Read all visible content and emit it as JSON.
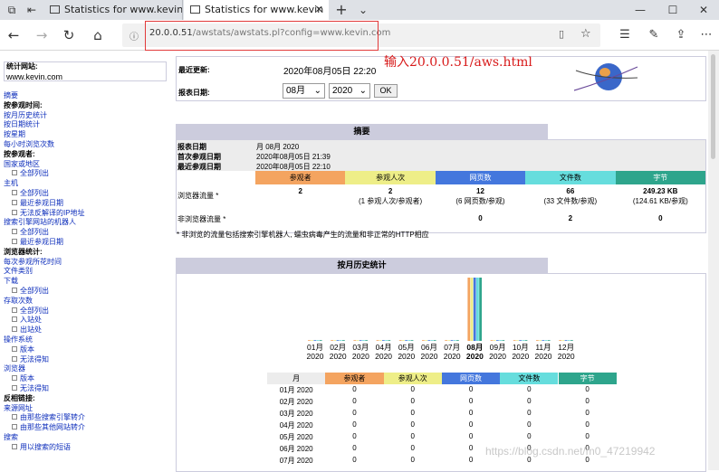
{
  "browser": {
    "tab1_title": "Statistics for www.kevin.com",
    "tab2_title": "Statistics for www.kevin",
    "url_host": "20.0.0.51",
    "url_path": "/awstats/awstats.pl?config=www.kevin.com",
    "annotation": "输入20.0.0.51/aws.html"
  },
  "sidebar": {
    "site_label": "统计网站:",
    "site_value": "www.kevin.com",
    "items": [
      {
        "t": "摘要",
        "s": "link",
        "l": 0
      },
      {
        "t": "按参观时间:",
        "s": "bold",
        "l": 0
      },
      {
        "t": "按月历史统计",
        "s": "link",
        "l": 0
      },
      {
        "t": "按日期统计",
        "s": "link",
        "l": 0
      },
      {
        "t": "按星期",
        "s": "link",
        "l": 0
      },
      {
        "t": "每小时浏览次数",
        "s": "link",
        "l": 0
      },
      {
        "t": "按参观者:",
        "s": "bold",
        "l": 0
      },
      {
        "t": "国家或地区",
        "s": "link",
        "l": 0
      },
      {
        "t": "全部列出",
        "s": "link",
        "l": 1
      },
      {
        "t": "主机",
        "s": "link",
        "l": 0
      },
      {
        "t": "全部列出",
        "s": "link",
        "l": 1
      },
      {
        "t": "最近参观日期",
        "s": "link",
        "l": 1
      },
      {
        "t": "无法反解译的IP地址",
        "s": "link",
        "l": 1
      },
      {
        "t": "搜索引擎网站的机器人",
        "s": "link",
        "l": 0
      },
      {
        "t": "全部列出",
        "s": "link",
        "l": 1
      },
      {
        "t": "最近参观日期",
        "s": "link",
        "l": 1
      },
      {
        "t": "浏览器统计:",
        "s": "bold",
        "l": 0
      },
      {
        "t": "每次参观所花时间",
        "s": "link",
        "l": 0
      },
      {
        "t": "文件类别",
        "s": "link",
        "l": 0
      },
      {
        "t": "下载",
        "s": "link",
        "l": 0
      },
      {
        "t": "全部列出",
        "s": "link",
        "l": 1
      },
      {
        "t": "存取次数",
        "s": "link",
        "l": 0
      },
      {
        "t": "全部列出",
        "s": "link",
        "l": 1
      },
      {
        "t": "入站处",
        "s": "link",
        "l": 1
      },
      {
        "t": "出站处",
        "s": "link",
        "l": 1
      },
      {
        "t": "操作系统",
        "s": "link",
        "l": 0
      },
      {
        "t": "版本",
        "s": "link",
        "l": 1
      },
      {
        "t": "无法得知",
        "s": "link",
        "l": 1
      },
      {
        "t": "浏览器",
        "s": "link",
        "l": 0
      },
      {
        "t": "版本",
        "s": "link",
        "l": 1
      },
      {
        "t": "无法得知",
        "s": "link",
        "l": 1
      },
      {
        "t": "反相链接:",
        "s": "bold",
        "l": 0
      },
      {
        "t": "来源网址",
        "s": "link",
        "l": 0
      },
      {
        "t": "由那些搜索引擎转介",
        "s": "link",
        "l": 1
      },
      {
        "t": "由那些其他网站转介",
        "s": "link",
        "l": 1
      },
      {
        "t": "搜索",
        "s": "link",
        "l": 0
      },
      {
        "t": "用以搜索的短语",
        "s": "link",
        "l": 1
      }
    ]
  },
  "top": {
    "last_update_label": "最近更新:",
    "last_update_value": "2020年08月05日 22:20",
    "period_label": "报表日期:",
    "month": "08月",
    "year": "2020",
    "ok": "OK"
  },
  "summary": {
    "title": "摘要",
    "rows": [
      {
        "label": "报表日期",
        "value": "月 08月 2020"
      },
      {
        "label": "首次参观日期",
        "value": "2020年08月05日 21:39"
      },
      {
        "label": "最近参观日期",
        "value": "2020年08月05日 22:10"
      }
    ],
    "cols": [
      "参观者",
      "参观人次",
      "网页数",
      "文件数",
      "字节"
    ],
    "traffic_label": "浏览器流量 *",
    "traffic_values": [
      "2",
      "2",
      "12",
      "66",
      "249.23 KB"
    ],
    "traffic_sub": [
      "",
      "(1 参观人次/参观者)",
      "(6 网页数/参观)",
      "(33 文件数/参观)",
      "(124.61 KB/参观)"
    ],
    "nontraffic_label": "非浏览器流量 *",
    "nontraffic_values": [
      "",
      "",
      "0",
      "2",
      "0"
    ],
    "note": "* 非浏览的流量包括搜索引擎机器人, 蠕虫病毒产生的流量和非正常的HTTP相应"
  },
  "monthly": {
    "title": "按月历史统计",
    "months": [
      "01月",
      "02月",
      "03月",
      "04月",
      "05月",
      "06月",
      "07月",
      "08月",
      "09月",
      "10月",
      "11月",
      "12月"
    ],
    "year": "2020",
    "cols": [
      "月",
      "参观者",
      "参观人次",
      "网页数",
      "文件数",
      "字节"
    ],
    "rows": [
      [
        "01月 2020",
        "0",
        "0",
        "0",
        "0",
        "0"
      ],
      [
        "02月 2020",
        "0",
        "0",
        "0",
        "0",
        "0"
      ],
      [
        "03月 2020",
        "0",
        "0",
        "0",
        "0",
        "0"
      ],
      [
        "04月 2020",
        "0",
        "0",
        "0",
        "0",
        "0"
      ],
      [
        "05月 2020",
        "0",
        "0",
        "0",
        "0",
        "0"
      ],
      [
        "06月 2020",
        "0",
        "0",
        "0",
        "0",
        "0"
      ],
      [
        "07月 2020",
        "0",
        "0",
        "0",
        "0",
        "0"
      ]
    ]
  },
  "chart_data": {
    "type": "bar",
    "categories": [
      "01月",
      "02月",
      "03月",
      "04月",
      "05月",
      "06月",
      "07月",
      "08月",
      "09月",
      "10月",
      "11月",
      "12月"
    ],
    "series": [
      {
        "name": "参观者",
        "values": [
          0,
          0,
          0,
          0,
          0,
          0,
          0,
          2,
          0,
          0,
          0,
          0
        ]
      },
      {
        "name": "参观人次",
        "values": [
          0,
          0,
          0,
          0,
          0,
          0,
          0,
          2,
          0,
          0,
          0,
          0
        ]
      },
      {
        "name": "网页数",
        "values": [
          0,
          0,
          0,
          0,
          0,
          0,
          0,
          12,
          0,
          0,
          0,
          0
        ]
      },
      {
        "name": "文件数",
        "values": [
          0,
          0,
          0,
          0,
          0,
          0,
          0,
          66,
          0,
          0,
          0,
          0
        ]
      },
      {
        "name": "字节",
        "values": [
          0,
          0,
          0,
          0,
          0,
          0,
          0,
          249.23,
          0,
          0,
          0,
          0
        ]
      }
    ],
    "colors": [
      "#f4a460",
      "#eeee88",
      "#4477dd",
      "#66dddd",
      "#2ea58c"
    ]
  },
  "watermark": "https://blog.csdn.net/m0_47219942"
}
